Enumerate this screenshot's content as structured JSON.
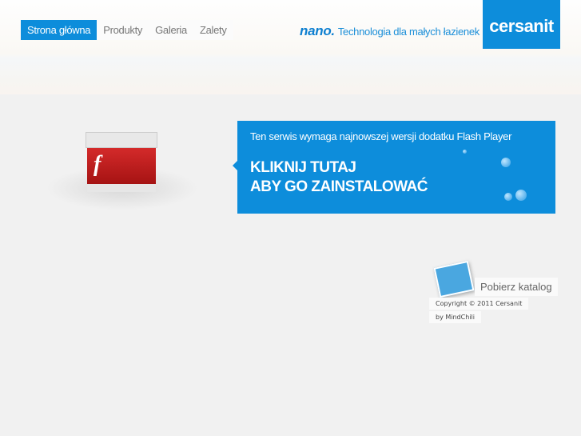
{
  "nav": {
    "items": [
      "Strona główna",
      "Produkty",
      "Galeria",
      "Zalety"
    ],
    "active": 0
  },
  "tagline": {
    "brand": "nano.",
    "text": "Technologia dla małych łazienek"
  },
  "logo": "cersanit",
  "flash": {
    "message": "Ten serwis wymaga najnowszej wersji dodatku Flash Player",
    "cta_line1": "KLIKNIJ TUTAJ",
    "cta_line2": "ABY GO ZAINSTALOWAĆ"
  },
  "footer": {
    "catalog": "Pobierz katalog",
    "copyright": "Copyright © 2011 Cersanit",
    "credit": "by MindChili"
  },
  "colors": {
    "accent": "#0d8ddb"
  }
}
